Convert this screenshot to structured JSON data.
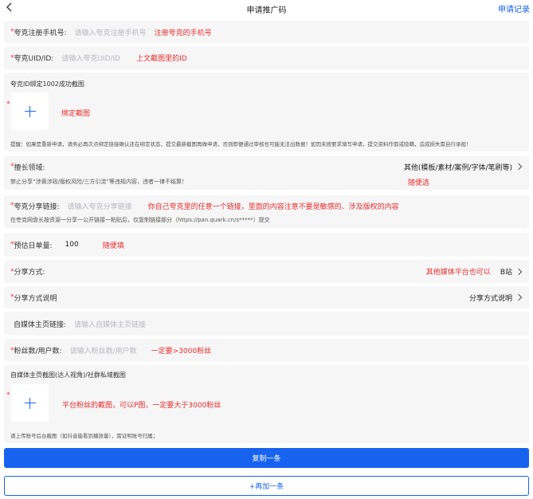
{
  "header": {
    "title": "申请推广码",
    "records_link": "申请记录"
  },
  "fields": {
    "phone": {
      "label": "夸克注册手机号:",
      "placeholder": "请输入夸克注册手机号",
      "note": "注册夸克的手机号"
    },
    "uid": {
      "label": "夸克UID/ID:",
      "placeholder": "请输入夸克UID/ID",
      "note": "上文截图里的ID"
    },
    "bind_screenshot": {
      "label": "夸克ID绑定1002成功截图",
      "note": "绑定截图",
      "hint": "提醒：如果是重新申请，请务必再次点绑定链接确认还在绑定状态，提交最新截图再做申请，否则即便通过审核也可能无法出数据！如因未按要求填写申请，提交资料作假或隐瞒，造成损失需自行承担！"
    },
    "expertise": {
      "label": "擅长领域:",
      "value": "其他(模板/素材/案例/字体/笔刷等)",
      "hint": "禁止分享“涉黄涉政/版权风险/三方引流”等违规内容，违者一律不结算！",
      "note": "随便选"
    },
    "share_link": {
      "label": "夸克分享链接:",
      "placeholder": "请输入夸克分享链接",
      "note": "你自己夸克里的任意一个链接，里面的内容注意不要是敏感的、涉及版权的内容",
      "hint": "在夸克网盘长按资源一分享一公开链接一粘贴后，仅复制链接部分（https://pan.quark.cn/s*****）提交"
    },
    "daily_estimate": {
      "label": "预估日单量:",
      "value": "100",
      "note": "随便填"
    },
    "share_method": {
      "label": "分享方式:",
      "note": "其他媒体平台也可以",
      "value": "B站"
    },
    "share_desc": {
      "label": "分享方式说明",
      "value": "分享方式说明"
    },
    "media_link": {
      "label": "自媒体主页链接:",
      "placeholder": "请输入自媒体主页链接"
    },
    "followers": {
      "label": "粉丝数/用户数:",
      "placeholder": "请输入粉丝数/用户数",
      "note": "一定要>3000粉丝"
    },
    "media_screenshot": {
      "label": "自媒体主页截图(达人视角)/社群私域截图",
      "note": "平台粉丝的截图，可以P图，一定要大于3000粉丝",
      "hint": "请上传账号后台截图（如抖音能看到播放量），需证明账号归属；"
    }
  },
  "required_mark": "*",
  "buttons": {
    "copy": "复制一条",
    "add": "+再加一条"
  },
  "colors": {
    "primary": "#1763f0",
    "note_red": "#e52d2d",
    "card_bg": "#f6f6f7"
  },
  "icons": {
    "back": "chevron-left-icon",
    "chevron": "chevron-right-icon",
    "upload": "plus-icon"
  }
}
